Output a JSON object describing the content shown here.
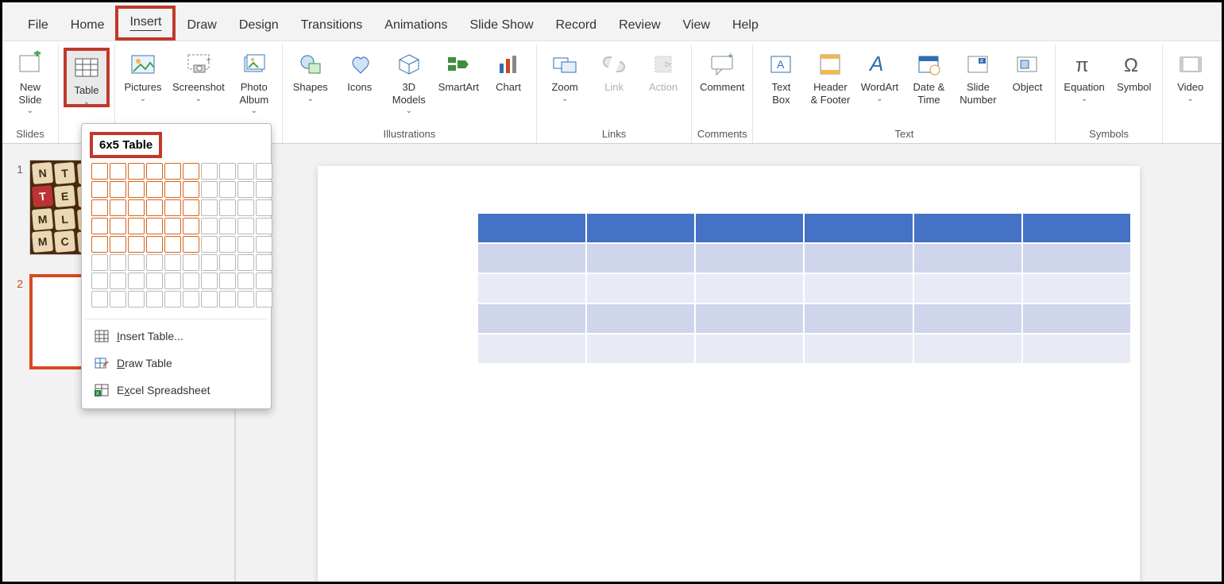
{
  "tabs": {
    "file": "File",
    "home": "Home",
    "insert": "Insert",
    "draw": "Draw",
    "design": "Design",
    "transitions": "Transitions",
    "animations": "Animations",
    "slideshow": "Slide Show",
    "record": "Record",
    "review": "Review",
    "view": "View",
    "help": "Help"
  },
  "ribbon": {
    "slides": {
      "label": "Slides",
      "new_slide": "New\nSlide"
    },
    "tables": {
      "table": "Table"
    },
    "images": {
      "pictures": "Pictures",
      "screenshot": "Screenshot",
      "photo_album": "Photo\nAlbum"
    },
    "illustrations": {
      "label": "Illustrations",
      "shapes": "Shapes",
      "icons": "Icons",
      "models": "3D\nModels",
      "smartart": "SmartArt",
      "chart": "Chart"
    },
    "links": {
      "label": "Links",
      "zoom": "Zoom",
      "link": "Link",
      "action": "Action"
    },
    "comments": {
      "label": "Comments",
      "comment": "Comment"
    },
    "text": {
      "label": "Text",
      "textbox": "Text\nBox",
      "header": "Header\n& Footer",
      "wordart": "WordArt",
      "datetime": "Date &\nTime",
      "slidenum": "Slide\nNumber",
      "object": "Object"
    },
    "symbols": {
      "label": "Symbols",
      "equation": "Equation",
      "symbol": "Symbol"
    },
    "media": {
      "video": "Video"
    }
  },
  "dropdown": {
    "title": "6x5 Table",
    "grid": {
      "cols": 10,
      "rows": 8,
      "sel_cols": 6,
      "sel_rows": 5
    },
    "insert_table": "Insert Table...",
    "draw_table": "Draw Table",
    "excel": "Excel Spreadsheet"
  },
  "thumbs": {
    "s1": "1",
    "s2": "2"
  },
  "preview_table": {
    "cols": 6,
    "rows": 5
  }
}
